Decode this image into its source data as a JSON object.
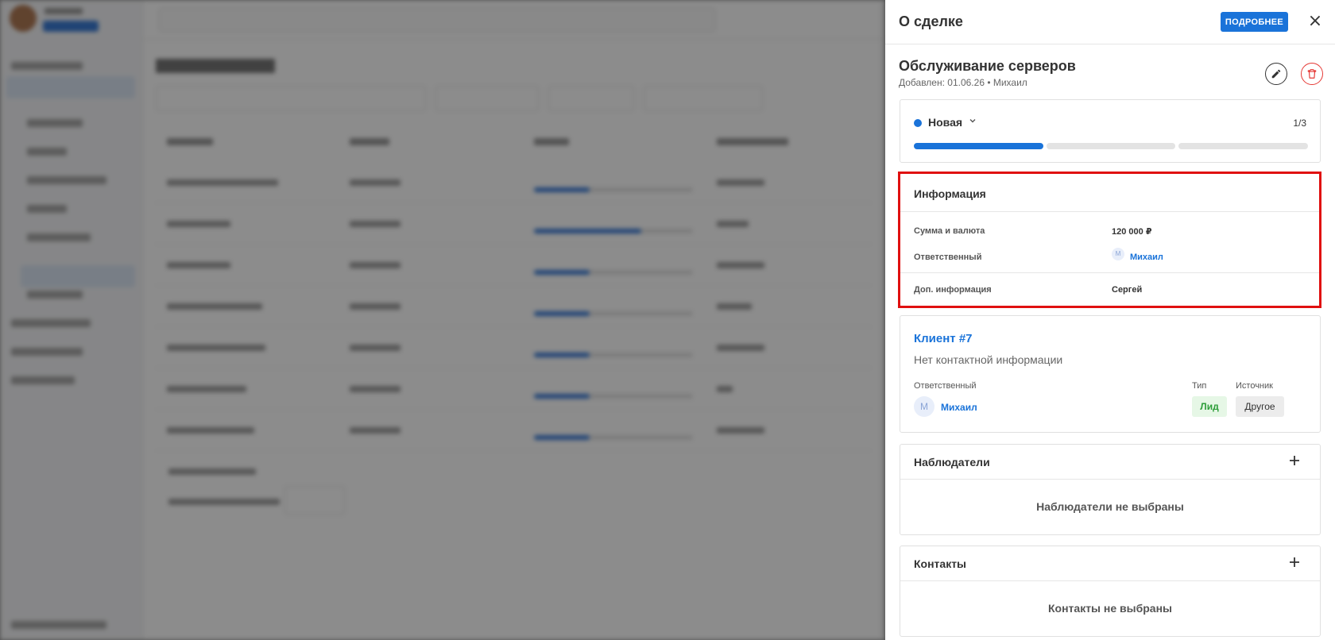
{
  "drawer": {
    "title": "О сделке",
    "more_button": "ПОДРОБНЕЕ",
    "close_glyph": "×"
  },
  "deal": {
    "name": "Обслуживание серверов",
    "meta": "Добавлен: 01.06.26 • Михаил"
  },
  "stage": {
    "label": "Новая",
    "counter": "1/3",
    "current_step": 1,
    "total_steps": 3,
    "color": "#1a73d9"
  },
  "info": {
    "title": "Информация",
    "amount_label": "Сумма и валюта",
    "amount_value": "120 000 ₽",
    "responsible_label": "Ответственный",
    "responsible_initial": "М",
    "responsible_name": "Михаил",
    "extra_label": "Доп. информация",
    "extra_value": "Сергей"
  },
  "client": {
    "title": "Клиент #7",
    "subtitle": "Нет контактной информации",
    "responsible_label": "Ответственный",
    "responsible_initial": "М",
    "responsible_name": "Михаил",
    "type_label": "Тип",
    "type_value": "Лид",
    "source_label": "Источник",
    "source_value": "Другое"
  },
  "watchers": {
    "title": "Наблюдатели",
    "empty": "Наблюдатели не выбраны"
  },
  "contacts": {
    "title": "Контакты",
    "empty": "Контакты не выбраны"
  },
  "icons": {
    "close": "close-icon",
    "edit": "pencil-icon",
    "delete": "trash-icon",
    "add": "plus-icon",
    "chevron": "chevron-down-icon"
  },
  "colors": {
    "accent": "#1a73d9",
    "danger": "#e53935",
    "highlight": "#e01010"
  }
}
